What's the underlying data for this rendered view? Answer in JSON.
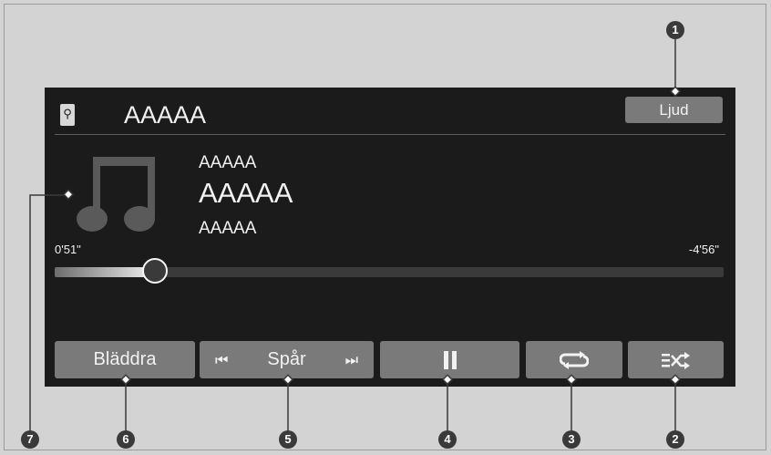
{
  "header": {
    "usb_icon": "usb-icon",
    "source_title": "AAAAA",
    "sound_button": "Ljud"
  },
  "track_info": {
    "album_art_icon": "music-note-icon",
    "line1": "AAAAA",
    "line2": "AAAAA",
    "line3": "AAAAA"
  },
  "progress": {
    "elapsed": "0'51\"",
    "remaining": "-4'56\"",
    "fraction": 0.15
  },
  "controls": {
    "browse_label": "Bläddra",
    "track_label": "Spår",
    "prev_icon": "skip-previous-icon",
    "next_icon": "skip-next-icon",
    "pause_icon": "pause-icon",
    "repeat_icon": "repeat-icon",
    "shuffle_icon": "shuffle-icon"
  },
  "callouts": [
    "1",
    "2",
    "3",
    "4",
    "5",
    "6",
    "7"
  ],
  "colors": {
    "background": "#d3d3d3",
    "screen": "#1b1b1b",
    "button": "#7a7a7a",
    "text": "#f2f2f2",
    "callout": "#3a3a3a"
  }
}
